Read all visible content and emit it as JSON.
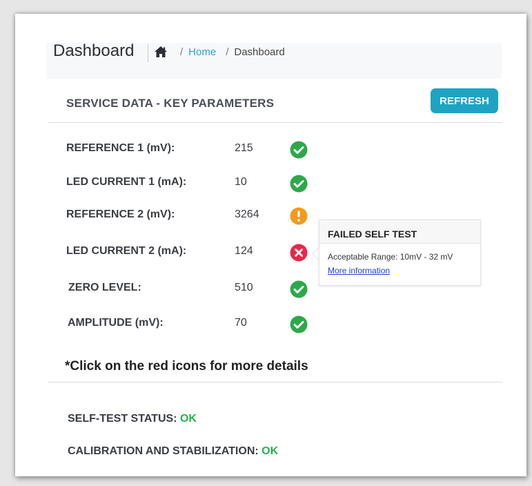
{
  "header": {
    "title": "Dashboard",
    "breadcrumb": {
      "home_icon": "home-icon",
      "separator": "/",
      "home_label": "Home",
      "current_label": "Dashboard"
    }
  },
  "card": {
    "title": "SERVICE DATA - KEY PARAMETERS",
    "refresh_label": "REFRESH",
    "refresh_color": "#1fa3c2"
  },
  "parameters": [
    {
      "label": "REFERENCE 1 (mV):",
      "value": "215",
      "status": "ok",
      "icon": "check-circle-icon"
    },
    {
      "label": "LED CURRENT 1 (mA):",
      "value": "10",
      "status": "ok",
      "icon": "check-circle-icon"
    },
    {
      "label": "REFERENCE 2 (mV):",
      "value": "3264",
      "status": "warning",
      "icon": "exclamation-circle-icon"
    },
    {
      "label": "LED CURRENT 2 (mA):",
      "value": "124",
      "status": "error",
      "icon": "x-circle-icon"
    },
    {
      "label": "ZERO LEVEL:",
      "value": "510",
      "status": "ok",
      "icon": "check-circle-icon"
    },
    {
      "label": "AMPLITUDE (mV):",
      "value": "70",
      "status": "ok",
      "icon": "check-circle-icon"
    }
  ],
  "status_colors": {
    "ok": "#2ea84a",
    "warning": "#f39a1b",
    "error": "#e8264a"
  },
  "tooltip": {
    "title": "FAILED SELF TEST",
    "text": "Acceptable Range: 10mV - 32 mV",
    "link_label": "More information"
  },
  "note": "*Click on the red icons for more details",
  "self_test": {
    "label": "SELF-TEST STATUS:",
    "value": "OK"
  },
  "calibration": {
    "label": "CALIBRATION AND STABILIZATION:",
    "value": "OK"
  }
}
